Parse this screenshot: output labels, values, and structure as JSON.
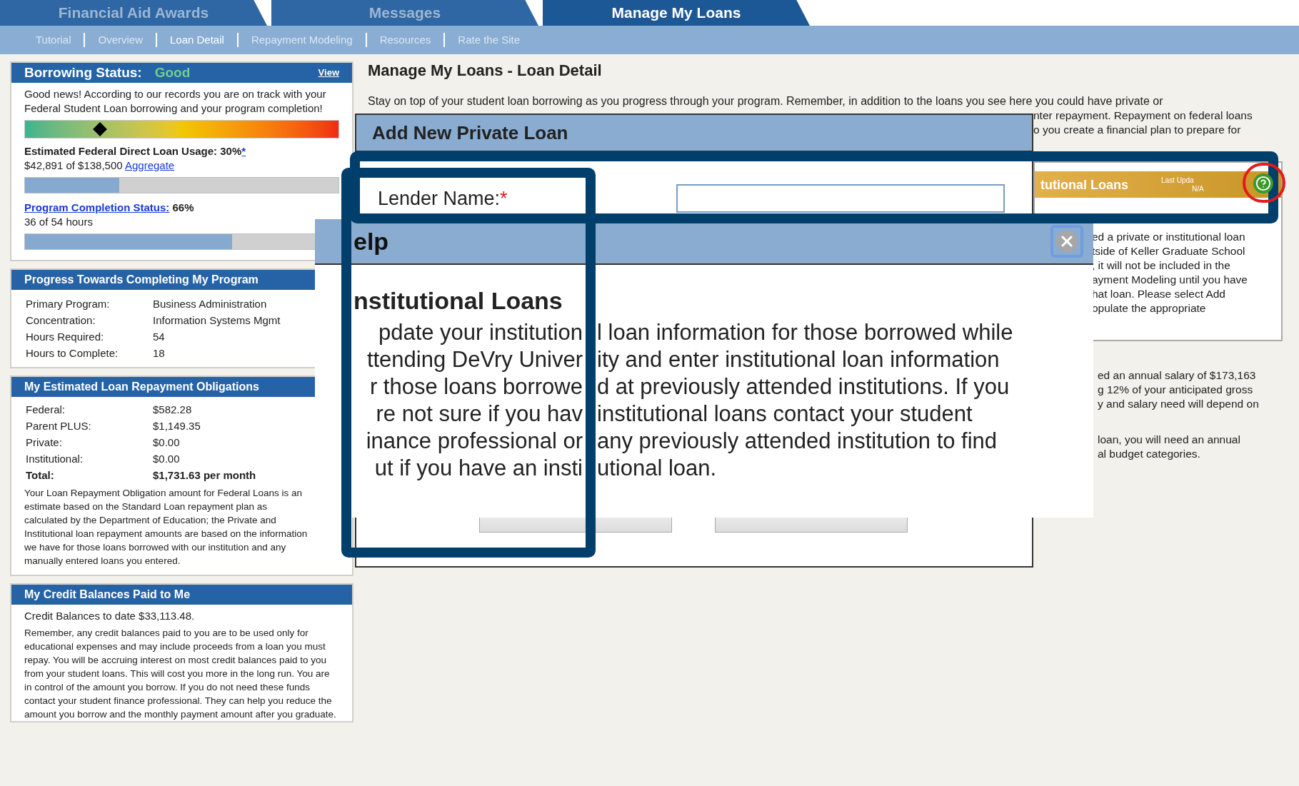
{
  "top_tabs": [
    {
      "label": "Financial Aid Awards",
      "selected": false
    },
    {
      "label": "Messages",
      "selected": false
    },
    {
      "label": "Manage My Loans",
      "selected": true
    }
  ],
  "sub_nav": [
    {
      "label": "Tutorial",
      "selected": false
    },
    {
      "label": "Overview",
      "selected": false
    },
    {
      "label": "Loan Detail",
      "selected": true
    },
    {
      "label": "Repayment Modeling",
      "selected": false
    },
    {
      "label": "Resources",
      "selected": false
    },
    {
      "label": "Rate the Site",
      "selected": false
    }
  ],
  "borrowing_status": {
    "title": "Borrowing Status:",
    "status": "Good",
    "link": "View",
    "message": "Good news! According to our records you are on track with your Federal Student Loan borrowing and your program completion!",
    "status_scale": {
      "level": 0.24
    },
    "usage": {
      "label": "Estimated Federal Direct Loan Usage: 30%",
      "footnote": "*",
      "amount": "$42,891 of $138,500",
      "link": "Aggregate",
      "level": 0.3
    },
    "completion": {
      "link": "Program Completion Status:",
      "value": "66%",
      "hours": "36 of 54 hours",
      "level": 0.66
    }
  },
  "program_progress": {
    "title": "Progress Towards Completing My Program",
    "rows": [
      {
        "label": "Primary Program:",
        "value": "Business Administration"
      },
      {
        "label": "Concentration:",
        "value": "Information Systems Mgmt"
      },
      {
        "label": "Hours Required:",
        "value": "54"
      },
      {
        "label": "Hours to Complete:",
        "value": "18"
      }
    ]
  },
  "repayment": {
    "title": "My Estimated Loan Repayment Obligations",
    "rows": [
      {
        "label": "Federal:",
        "value": "$582.28",
        "total": false
      },
      {
        "label": "Parent PLUS:",
        "value": "$1,149.35",
        "total": false
      },
      {
        "label": "Private:",
        "value": "$0.00",
        "total": false
      },
      {
        "label": "Institutional:",
        "value": "$0.00",
        "total": false
      },
      {
        "label": "Total:",
        "value": "$1,731.63 per month",
        "total": true
      }
    ],
    "note": "Your Loan Repayment Obligation amount for Federal Loans is an estimate based on the Standard Loan repayment plan as calculated by the Department of Education; the Private and Institutional loan repayment amounts are based on the information we have for those loans borrowed with our institution and any manually entered loans you entered."
  },
  "credit": {
    "title": "My Credit Balances Paid to Me",
    "balance": "Credit Balances to date $33,113.48.",
    "note": "Remember, any credit balances paid to you are to be used only for educational expenses and may include proceeds from a loan you must repay. You will be accruing interest on most credit balances paid to you from your student loans. This will cost you more in the long run. You are in control of the amount you borrow. If you do not need these funds contact your student finance professional. They can help you reduce the amount you borrow and the monthly payment amount after you graduate."
  },
  "main": {
    "title": "Manage My Loans - Loan Detail",
    "intro": "Stay on top of your student loan borrowing as you progress through your program. Remember, in addition to the loans you see here you could have private or",
    "intro_fragments": [
      "nter repayment. Repayment on federal loans",
      "o you create a financial plan to prepare for"
    ],
    "institutional_card": {
      "title": "tutional Loans",
      "updated_label": "Last Upda",
      "updated_value": "N/A",
      "lines": [
        "ed a private or institutional loan",
        "tside of Keller Graduate School",
        ", it will not be included in the",
        "ayment Modeling until you have",
        "hat loan. Please select Add",
        "opulate the appropriate"
      ]
    },
    "lower_groups": [
      [
        "ed an annual salary of $173,163",
        "g 12% of your anticipated gross",
        "y and salary need will depend on"
      ],
      [
        "loan, you will need an annual",
        "al budget categories."
      ]
    ]
  },
  "add_loan_dialog": {
    "title": "Add New Private Loan",
    "field": {
      "label": "Lender Name:",
      "required_mark": "*"
    }
  },
  "help_dialog": {
    "title": "elp",
    "heading": "nstitutional Loans",
    "lines": [
      [
        "pdate your institution",
        "l loan information for those borrowed while"
      ],
      [
        "ttending DeVry Univer",
        "ity and enter institutional loan information"
      ],
      [
        "r those loans borrowe",
        "d at previously attended institutions. If you"
      ],
      [
        "re not sure if you hav",
        "institutional loans contact your student"
      ],
      [
        "inance professional or",
        "any previously attended institution to find"
      ],
      [
        "ut if you have an insti",
        "utional loan."
      ]
    ]
  }
}
